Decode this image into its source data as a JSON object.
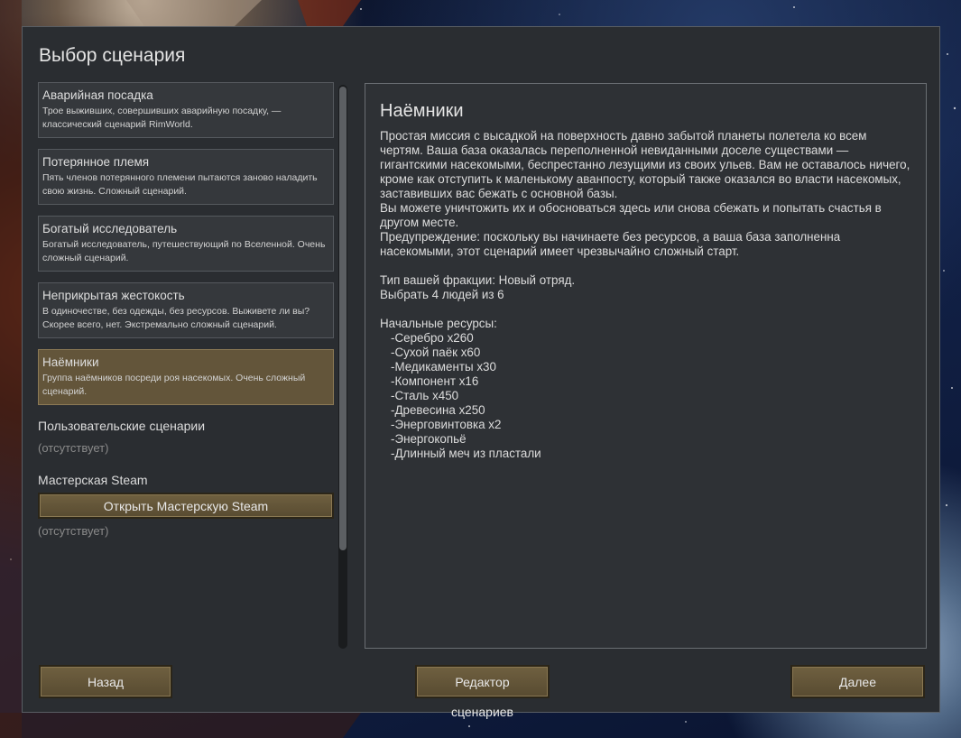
{
  "dialog": {
    "title": "Выбор сценария"
  },
  "scenarios": [
    {
      "title": "Аварийная посадка",
      "description": "Трое выживших, совершивших аварийную посадку, — классический сценарий RimWorld.",
      "selected": false
    },
    {
      "title": "Потерянное племя",
      "description": "Пять членов потерянного племени пытаются заново наладить свою жизнь. Сложный сценарий.",
      "selected": false
    },
    {
      "title": "Богатый исследователь",
      "description": "Богатый исследователь, путешествующий по Вселенной. Очень сложный сценарий.",
      "selected": false
    },
    {
      "title": "Неприкрытая жестокость",
      "description": "В одиночестве, без одежды, без ресурсов. Выживете ли вы? Скорее всего, нет. Экстремально сложный сценарий.",
      "selected": false
    },
    {
      "title": "Наёмники",
      "description": "Группа наёмников посреди роя насекомых. Очень сложный сценарий.",
      "selected": true
    }
  ],
  "custom": {
    "label": "Пользовательские сценарии",
    "empty": "(отсутствует)"
  },
  "workshop": {
    "label": "Мастерская Steam",
    "button": "Открыть Мастерскую Steam",
    "empty": "(отсутствует)"
  },
  "detail": {
    "title": "Наёмники",
    "paragraphs": [
      "Простая миссия с высадкой на поверхность давно забытой планеты полетела ко всем чертям. Ваша база оказалась переполненной невиданными доселе существами — гигантскими насекомыми, беспрестанно лезущими из своих ульев. Вам не оставалось ничего, кроме как отступить к маленькому аванпосту, который также оказался во власти насекомых, заставивших вас бежать с основной базы.",
      "Вы можете уничтожить их и обосноваться здесь или снова сбежать и попытать счастья в другом месте.",
      "Предупреждение: поскольку вы начинаете без ресурсов, а ваша база заполненна насекомыми, этот сценарий имеет чрезвычайно сложный старт."
    ],
    "faction": "Тип вашей фракции: Новый отряд.",
    "pick": "Выбрать 4 людей из 6",
    "resources_title": "Начальные ресурсы:",
    "resources": [
      "-Серебро x260",
      "-Сухой паёк x60",
      "-Медикаменты x30",
      "-Компонент x16",
      "-Сталь x450",
      "-Древесина x250",
      "-Энерговинтовка x2",
      "-Энергокопьё",
      "-Длинный меч из пластали"
    ]
  },
  "buttons": {
    "back": "Назад",
    "editor": "Редактор сценариев",
    "next": "Далее"
  }
}
